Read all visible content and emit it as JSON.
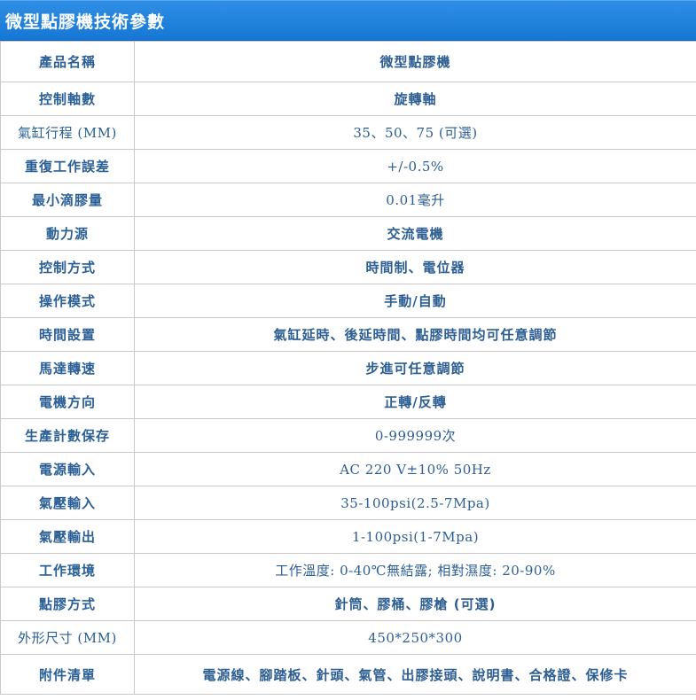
{
  "header": {
    "title": "微型點膠機技術參數"
  },
  "rows": [
    {
      "label": "產品名稱",
      "value": "微型點膠機"
    },
    {
      "label": "控制軸數",
      "value": "旋轉軸"
    },
    {
      "label": "氣缸行程 (MM)",
      "value": "35、50、75 (可選)"
    },
    {
      "label": "重復工作誤差",
      "value": "+/-0.5%"
    },
    {
      "label": "最小滴膠量",
      "value": "0.01毫升"
    },
    {
      "label": "動力源",
      "value": "交流電機"
    },
    {
      "label": "控制方式",
      "value": "時間制、電位器"
    },
    {
      "label": "操作模式",
      "value": "手動/自動"
    },
    {
      "label": "時間設置",
      "value": "氣缸延時、後延時間、點膠時間均可任意調節"
    },
    {
      "label": "馬達轉速",
      "value": "步進可任意調節"
    },
    {
      "label": "電機方向",
      "value": "正轉/反轉"
    },
    {
      "label": "生產計數保存",
      "value": "0-999999次"
    },
    {
      "label": "電源輸入",
      "value": "AC 220 V±10% 50Hz"
    },
    {
      "label": "氣壓輸入",
      "value": "35-100psi(2.5-7Mpa)"
    },
    {
      "label": "氣壓輸出",
      "value": "1-100psi(1-7Mpa)"
    },
    {
      "label": "工作環境",
      "value": "工作溫度: 0-40℃無結露; 相對濕度: 20-90%"
    },
    {
      "label": "點膠方式",
      "value": "針筒、膠桶、膠槍 (可選)"
    },
    {
      "label": "外形尺寸 (MM)",
      "value": "450*250*300"
    },
    {
      "label": "附件清單",
      "value": "電源線、腳踏板、針頭、氣管、出膠接頭、說明書、合格證、保修卡"
    }
  ]
}
